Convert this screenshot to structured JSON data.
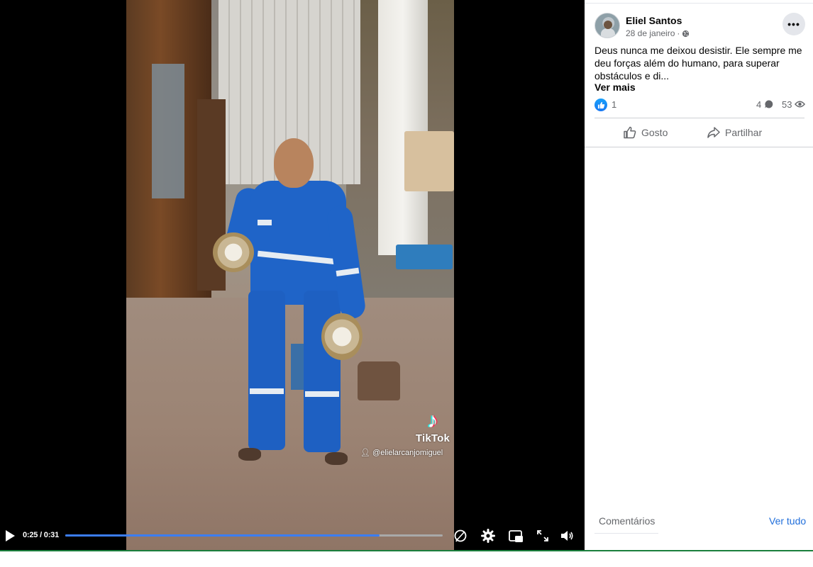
{
  "post": {
    "author": "Eliel Santos",
    "date": "28 de janeiro",
    "date_separator": "·",
    "privacy_icon": "globe-icon",
    "more_label": "•••",
    "text": "Deus nunca me deixou desistir. Ele sempre me deu forças além do humano, para superar obstáculos e di...",
    "see_more": "Ver mais"
  },
  "stats": {
    "likes": "1",
    "comments": "4",
    "views": "53"
  },
  "actions": {
    "like": "Gosto",
    "share": "Partilhar"
  },
  "comments": {
    "label": "Comentários",
    "see_all": "Ver tudo"
  },
  "video": {
    "time": "0:25 / 0:31",
    "progress": 0.833,
    "watermark_brand": "TikTok",
    "watermark_handle": "@elielarcanjomiguel"
  },
  "colors": {
    "accent": "#1877f2",
    "progress": "#3b7df4",
    "link": "#216fdb"
  }
}
